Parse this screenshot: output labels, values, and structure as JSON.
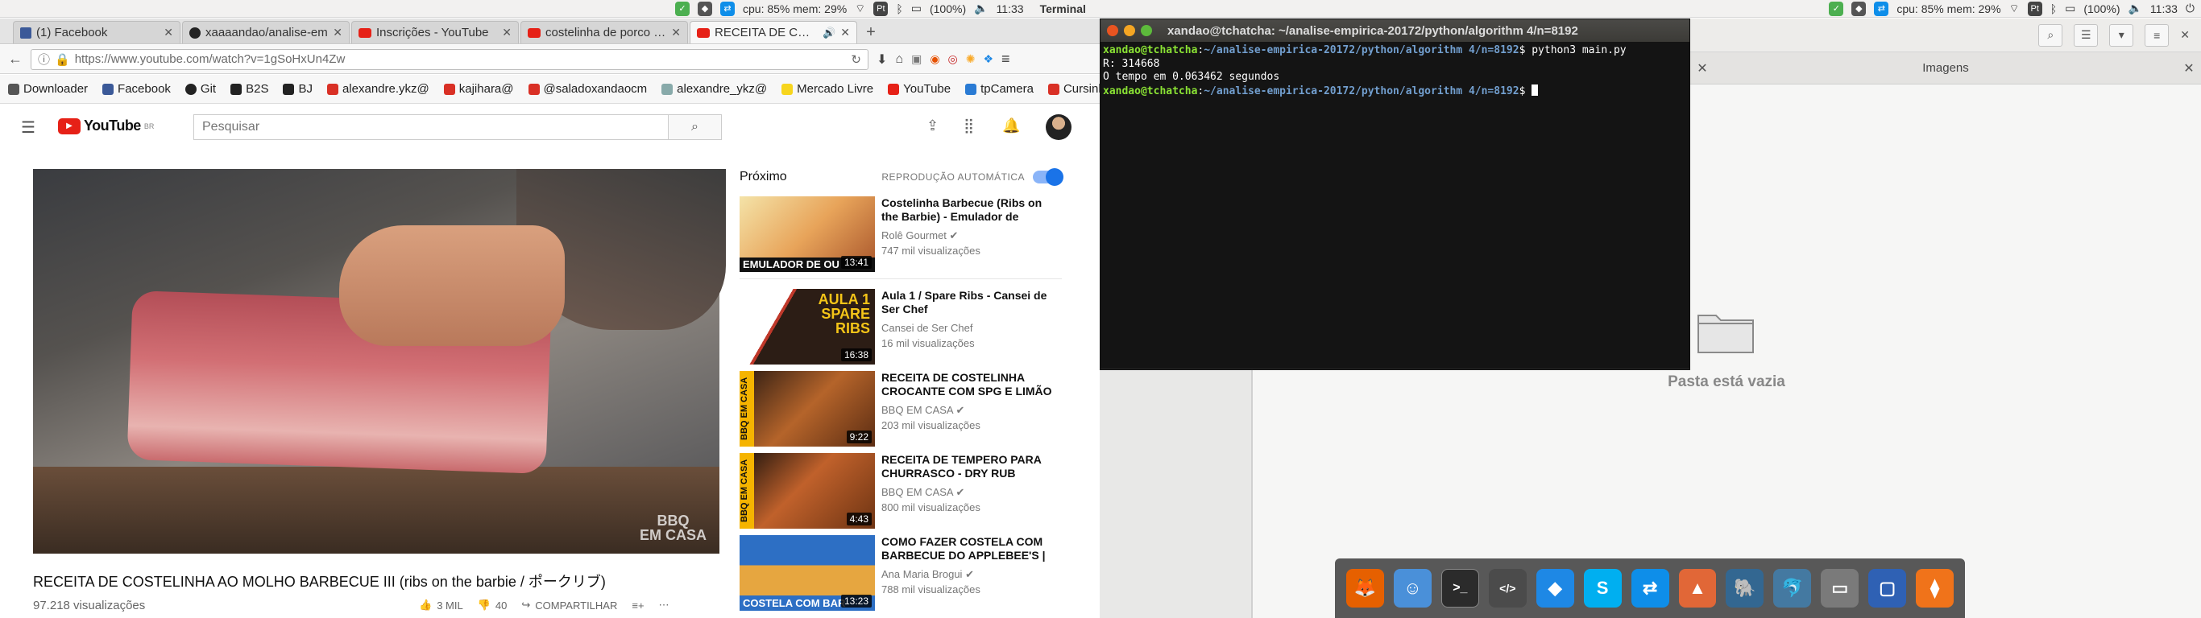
{
  "system_bar": {
    "cpu_mem": "cpu: 85% mem: 29%",
    "battery": "(100%)",
    "time": "11:33",
    "active_app": "Terminal",
    "right_cpu_mem": "cpu: 85% mem: 29%",
    "right_battery": "(100%)",
    "right_time": "11:33"
  },
  "browser": {
    "tabs": [
      {
        "label": "(1) Facebook",
        "icon_color": "#3b5998"
      },
      {
        "label": "xaaaandao/analise-em",
        "icon_color": "#222222"
      },
      {
        "label": "Inscrições - YouTube",
        "icon_color": "#e62117"
      },
      {
        "label": "costelinha de porco ao",
        "icon_color": "#e62117"
      },
      {
        "label": "RECEITA DE COSTEL",
        "icon_color": "#e62117"
      }
    ],
    "new_tab_label": "+",
    "url": "https://www.youtube.com/watch?v=1gSoHxUn4Zw",
    "bookmarks": [
      {
        "label": "Downloader",
        "color": "#555555"
      },
      {
        "label": "Facebook",
        "color": "#3b5998"
      },
      {
        "label": "Git",
        "color": "#222222"
      },
      {
        "label": "B2S",
        "color": "#222222"
      },
      {
        "label": "BJ",
        "color": "#222222"
      },
      {
        "label": "alexandre.ykz@",
        "color": "#d93025"
      },
      {
        "label": "kajihara@",
        "color": "#d93025"
      },
      {
        "label": "@saladoxandaocm",
        "color": "#d93025"
      },
      {
        "label": "alexandre_ykz@",
        "color": "#8aa"
      },
      {
        "label": "Mercado Livre",
        "color": "#f7d51d"
      },
      {
        "label": "YouTube",
        "color": "#e62117"
      },
      {
        "label": "tpCamera",
        "color": "#2a7bd4"
      },
      {
        "label": "Cursinho",
        "color": "#d93025"
      }
    ]
  },
  "youtube": {
    "logo_text": "YouTube",
    "logo_sup": "BR",
    "search_placeholder": "Pesquisar",
    "video_watermark": "BBQ\nEM CASA",
    "video_title": "RECEITA DE COSTELINHA AO MOLHO BARBECUE III (ribs on the barbie / ポークリブ)",
    "views": "97.218 visualizações",
    "likes": "3 MIL",
    "dislikes": "40",
    "share_label": "COMPARTILHAR",
    "up_next_label": "Próximo",
    "autoplay_label": "REPRODUÇÃO AUTOMÁTICA",
    "recommendations": [
      {
        "title": "Costelinha Barbecue (Ribs on the Barbie) - Emulador de",
        "channel": "Rolê Gourmet",
        "views": "747 mil visualizações",
        "duration": "13:41",
        "thumb_overlay": "EMULADOR DE OU"
      },
      {
        "title": "Aula 1 / Spare Ribs - Cansei de Ser Chef",
        "channel": "Cansei de Ser Chef",
        "views": "16 mil visualizações",
        "duration": "16:38",
        "thumb_overlay": "AULA 1 SPARE RIBS"
      },
      {
        "title": "RECEITA DE COSTELINHA CROCANTE COM SPG E LIMÃO",
        "channel": "BBQ EM CASA",
        "views": "203 mil visualizações",
        "duration": "9:22",
        "thumb_overlay": "BBQ EM CASA"
      },
      {
        "title": "RECEITA DE TEMPERO PARA CHURRASCO - DRY RUB",
        "channel": "BBQ EM CASA",
        "views": "800 mil visualizações",
        "duration": "4:43",
        "thumb_overlay": "BBQ EM CASA"
      },
      {
        "title": "COMO FAZER COSTELA COM BARBECUE DO APPLEBEE'S |",
        "channel": "Ana Maria Brogui",
        "views": "788 mil visualizações",
        "duration": "13:23",
        "thumb_overlay": "COSTELA COM BAR"
      }
    ]
  },
  "terminal": {
    "title": "xandao@tchatcha: ~/analise-empirica-20172/python/algorithm 4/n=8192",
    "user_host": "xandao@tchatcha",
    "path": "~/analise-empirica-20172/python/algorithm 4/n=8192",
    "command": "python3 main.py",
    "output_lines": [
      "R: 314668",
      "O tempo em 0.063462 segundos"
    ]
  },
  "file_manager": {
    "tab_label": "Imagens",
    "empty_text": "Pasta está vazia"
  },
  "dock": {
    "icons": [
      {
        "name": "firefox",
        "color": "#e66000",
        "glyph": "🦊"
      },
      {
        "name": "finder",
        "color": "#4a90d9",
        "glyph": "☺"
      },
      {
        "name": "terminal",
        "color": "#2b2b2b",
        "glyph": ">_"
      },
      {
        "name": "sublime",
        "color": "#4b4b4b",
        "glyph": "</>"
      },
      {
        "name": "dropbox",
        "color": "#1e88e5",
        "glyph": "◆"
      },
      {
        "name": "skype",
        "color": "#00aff0",
        "glyph": "S"
      },
      {
        "name": "teamviewer",
        "color": "#0e8ee9",
        "glyph": "⇄"
      },
      {
        "name": "matlab",
        "color": "#e16737",
        "glyph": "▲"
      },
      {
        "name": "postgres",
        "color": "#336791",
        "glyph": "🐘"
      },
      {
        "name": "mysql",
        "color": "#4479a1",
        "glyph": "🐬"
      },
      {
        "name": "filezilla",
        "color": "#7a7a7a",
        "glyph": "▭"
      },
      {
        "name": "virtualbox",
        "color": "#2f61b4",
        "glyph": "▢"
      },
      {
        "name": "ubuntu-software",
        "color": "#f0731a",
        "glyph": "⧫"
      }
    ]
  }
}
